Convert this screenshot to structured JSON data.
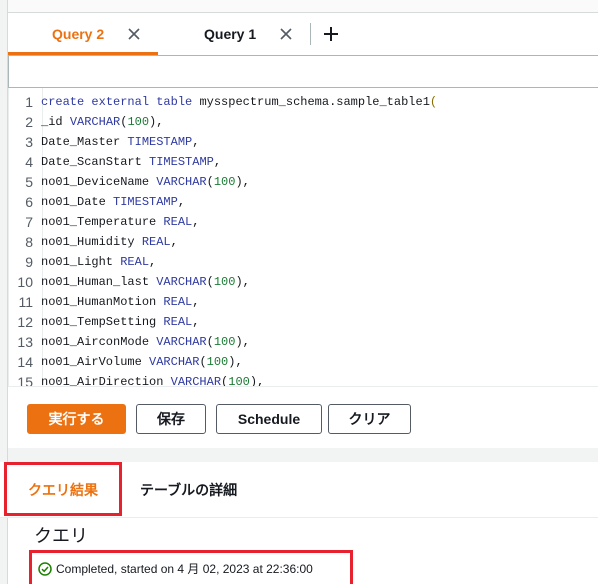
{
  "editor_tabs": [
    {
      "label": "Query 2",
      "active": true
    },
    {
      "label": "Query 1",
      "active": false
    }
  ],
  "editor": {
    "lines": [
      {
        "n": "1",
        "tokens": [
          [
            "kw",
            "create"
          ],
          [
            "t",
            " "
          ],
          [
            "kw",
            "external"
          ],
          [
            "t",
            " "
          ],
          [
            "kw",
            "table"
          ],
          [
            "t",
            " mysspectrum_schema.sample_table1"
          ],
          [
            "paren",
            "("
          ]
        ]
      },
      {
        "n": "2",
        "tokens": [
          [
            "t",
            "_id "
          ],
          [
            "kw",
            "VARCHAR"
          ],
          [
            "t",
            "("
          ],
          [
            "num",
            "100"
          ],
          [
            "t",
            "),"
          ]
        ]
      },
      {
        "n": "3",
        "tokens": [
          [
            "t",
            "Date_Master "
          ],
          [
            "kw",
            "TIMESTAMP"
          ],
          [
            "t",
            ","
          ]
        ]
      },
      {
        "n": "4",
        "tokens": [
          [
            "t",
            "Date_ScanStart "
          ],
          [
            "kw",
            "TIMESTAMP"
          ],
          [
            "t",
            ","
          ]
        ]
      },
      {
        "n": "5",
        "tokens": [
          [
            "t",
            "no01_DeviceName "
          ],
          [
            "kw",
            "VARCHAR"
          ],
          [
            "t",
            "("
          ],
          [
            "num",
            "100"
          ],
          [
            "t",
            "),"
          ]
        ]
      },
      {
        "n": "6",
        "tokens": [
          [
            "t",
            "no01_Date "
          ],
          [
            "kw",
            "TIMESTAMP"
          ],
          [
            "t",
            ","
          ]
        ]
      },
      {
        "n": "7",
        "tokens": [
          [
            "t",
            "no01_Temperature "
          ],
          [
            "kw",
            "REAL"
          ],
          [
            "t",
            ","
          ]
        ]
      },
      {
        "n": "8",
        "tokens": [
          [
            "t",
            "no01_Humidity "
          ],
          [
            "kw",
            "REAL"
          ],
          [
            "t",
            ","
          ]
        ]
      },
      {
        "n": "9",
        "tokens": [
          [
            "t",
            "no01_Light "
          ],
          [
            "kw",
            "REAL"
          ],
          [
            "t",
            ","
          ]
        ]
      },
      {
        "n": "10",
        "tokens": [
          [
            "t",
            "no01_Human_last "
          ],
          [
            "kw",
            "VARCHAR"
          ],
          [
            "t",
            "("
          ],
          [
            "num",
            "100"
          ],
          [
            "t",
            "),"
          ]
        ]
      },
      {
        "n": "11",
        "tokens": [
          [
            "t",
            "no01_HumanMotion "
          ],
          [
            "kw",
            "REAL"
          ],
          [
            "t",
            ","
          ]
        ]
      },
      {
        "n": "12",
        "tokens": [
          [
            "t",
            "no01_TempSetting "
          ],
          [
            "kw",
            "REAL"
          ],
          [
            "t",
            ","
          ]
        ]
      },
      {
        "n": "13",
        "tokens": [
          [
            "t",
            "no01_AirconMode "
          ],
          [
            "kw",
            "VARCHAR"
          ],
          [
            "t",
            "("
          ],
          [
            "num",
            "100"
          ],
          [
            "t",
            "),"
          ]
        ]
      },
      {
        "n": "14",
        "tokens": [
          [
            "t",
            "no01_AirVolume "
          ],
          [
            "kw",
            "VARCHAR"
          ],
          [
            "t",
            "("
          ],
          [
            "num",
            "100"
          ],
          [
            "t",
            "),"
          ]
        ]
      },
      {
        "n": "15",
        "tokens": [
          [
            "t",
            "no01_AirDirection "
          ],
          [
            "kw",
            "VARCHAR"
          ],
          [
            "t",
            "("
          ],
          [
            "num",
            "100"
          ],
          [
            "t",
            "),"
          ]
        ]
      }
    ]
  },
  "actions": {
    "run": "実行する",
    "save": "保存",
    "schedule": "Schedule",
    "clear": "クリア"
  },
  "result_tabs": [
    {
      "label": "クエリ結果",
      "active": true
    },
    {
      "label": "テーブルの詳細",
      "active": false
    }
  ],
  "result": {
    "heading": "クエリ",
    "status": "Completed, started on 4 月 02, 2023 at 22:36:00"
  },
  "colors": {
    "accent": "#ec7211",
    "highlight_box": "#e8212e",
    "success": "#1d8102"
  },
  "icons": {
    "tab_close": "close-icon",
    "new_tab": "plus-icon",
    "status": "check-circle-icon"
  }
}
